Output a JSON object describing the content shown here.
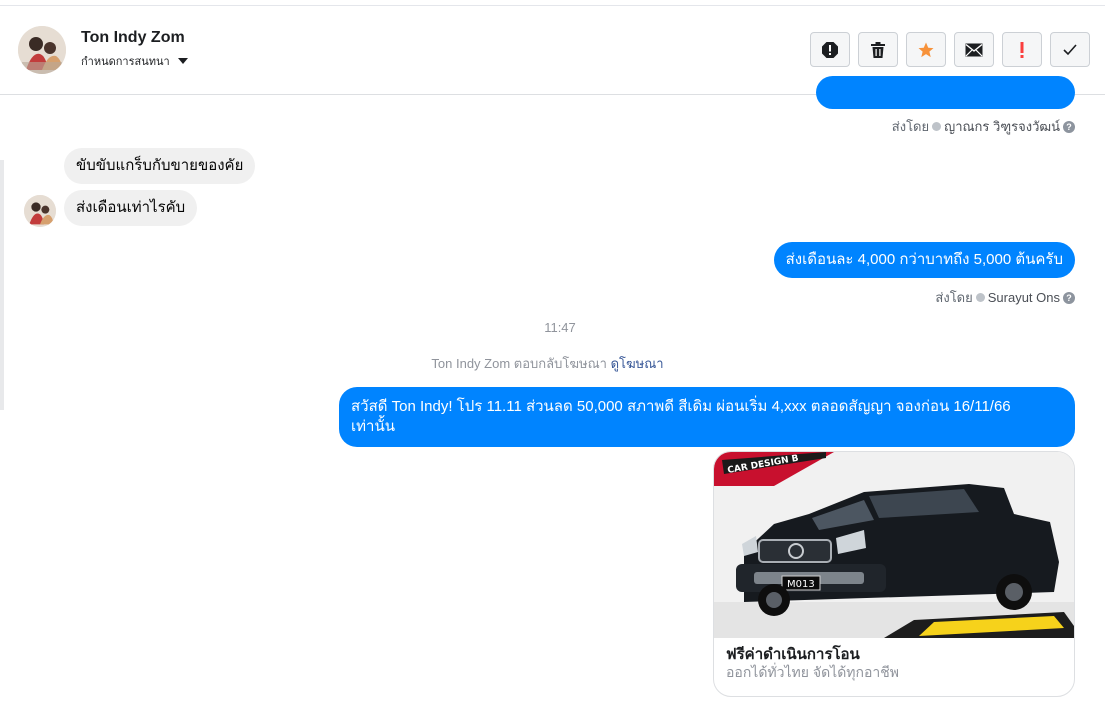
{
  "header": {
    "contact_name": "Ton Indy Zom",
    "subtitle": "กำหนดการสนทนา",
    "toolbar": [
      {
        "icon": "spam-icon",
        "name": "mark-spam-button"
      },
      {
        "icon": "trash-icon",
        "name": "delete-button"
      },
      {
        "icon": "star-icon",
        "name": "star-button"
      },
      {
        "icon": "envelope-icon",
        "name": "mark-unread-button"
      },
      {
        "icon": "exclamation-icon",
        "name": "mark-priority-button"
      },
      {
        "icon": "checkmark-icon",
        "name": "mark-done-button"
      }
    ]
  },
  "messages": {
    "sent_by_label": "ส่งโดย",
    "first_sent_by": "ญาณกร วิฑูรจงวัฒน์",
    "incoming_1": "ขับขับแกร็บกับขายของคัย",
    "incoming_2": "ส่งเดือนเท่าไรคับ",
    "outgoing_1": "ส่งเดือนละ 4,000 กว่าบาทถึง 5,000 ต้นครับ",
    "outgoing_1_sent_by": "Surayut Ons",
    "timestamp": "11:47",
    "ad_reply_text": "Ton Indy Zom ตอบกลับโฆษณา",
    "ad_reply_link": "ดูโฆษณา",
    "outgoing_2_line1": "สวัสดี Ton Indy! โปร 11.11 ส่วนลด 50,000 สภาพดี สีเดิม ผ่อนเริ่ม 4,xxx ตลอดสัญญา จองก่อน 16/11/66",
    "outgoing_2_line2": "เท่านั้น"
  },
  "card": {
    "title": "ฟรีค่าดำเนินการโอน",
    "subtitle": "ออกได้ทั่วไทย จัดได้ทุกอาชีพ",
    "banner_text": "CAR DESIGN B",
    "plate": "M013"
  },
  "colors": {
    "accent": "#0084ff",
    "star": "#f7923a",
    "priority": "#fa3e3e"
  }
}
